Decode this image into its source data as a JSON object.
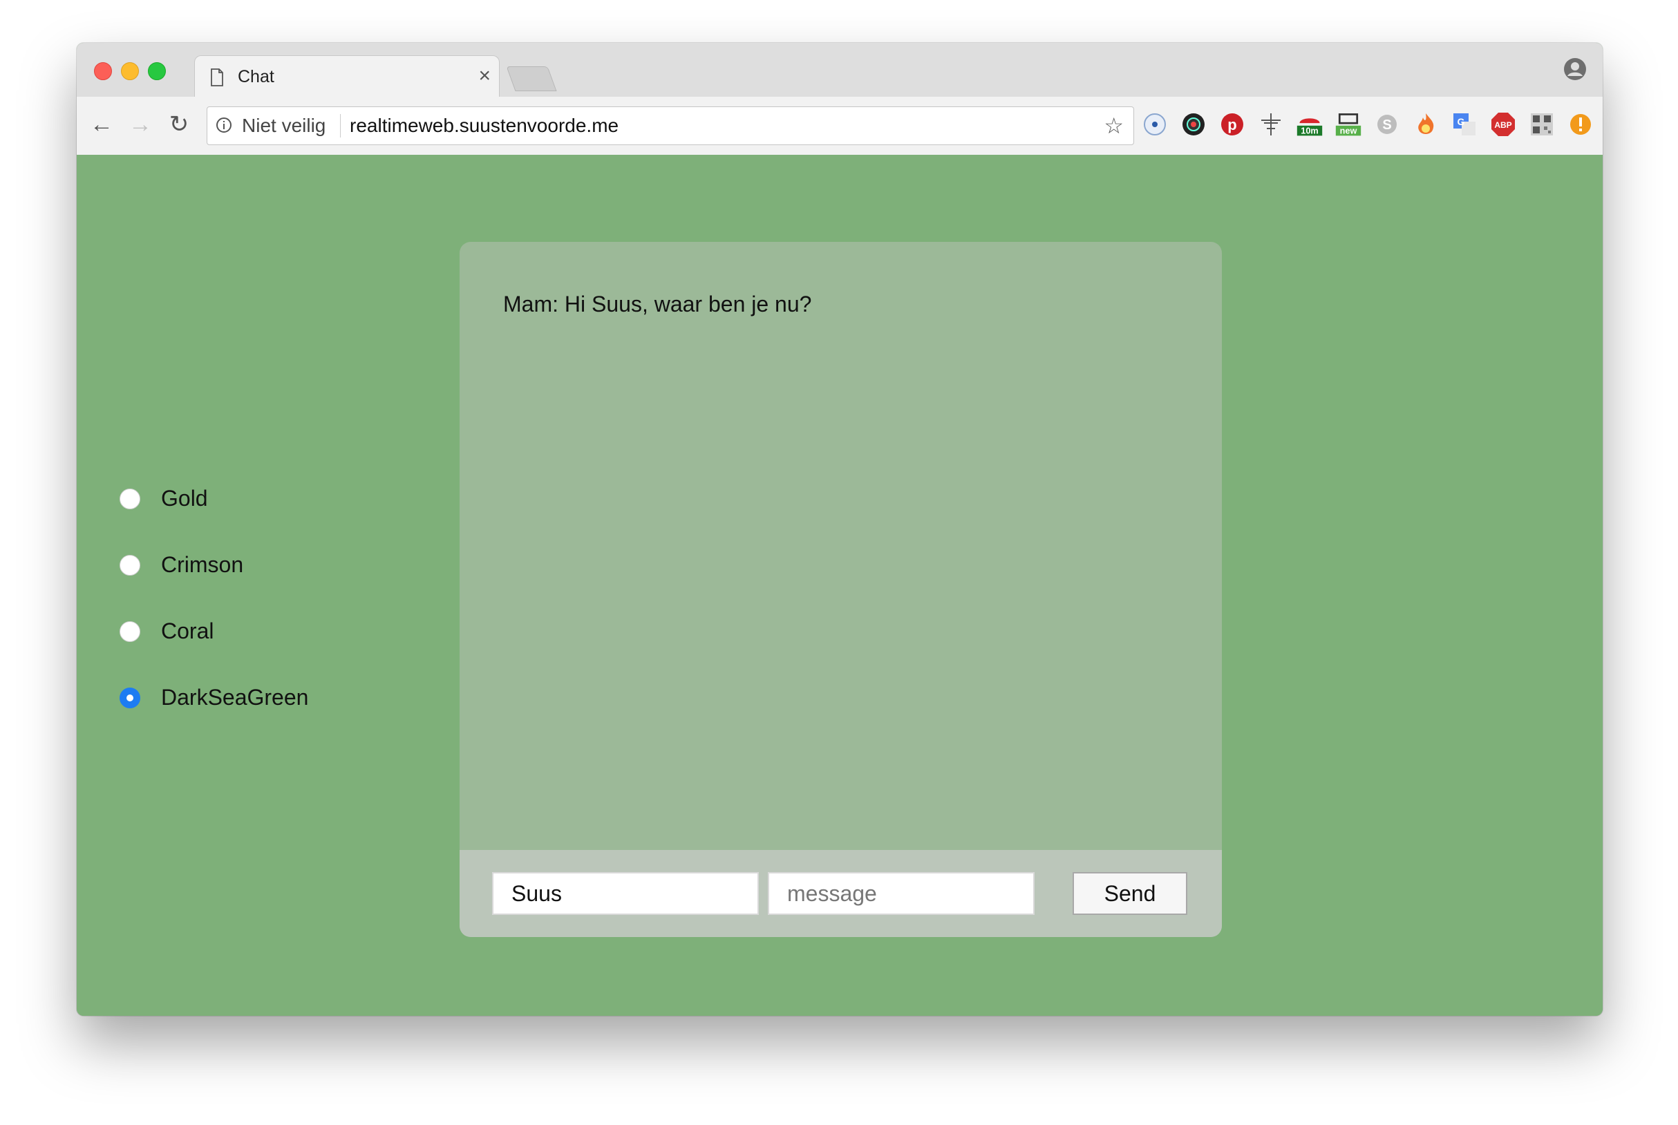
{
  "browser": {
    "tab_title": "Chat",
    "tab_close": "×",
    "security_label": "Niet veilig",
    "url": "realtimeweb.suustenvoorde.me",
    "extensions": [
      {
        "name": "circle-ext-icon"
      },
      {
        "name": "camera-ext-icon"
      },
      {
        "name": "pinterest-icon"
      },
      {
        "name": "move-cursor-icon"
      },
      {
        "name": "timer-ext-icon",
        "badge": "10m"
      },
      {
        "name": "window-ext-icon",
        "badge": "new"
      },
      {
        "name": "skype-icon"
      },
      {
        "name": "fire-ext-icon"
      },
      {
        "name": "translate-icon"
      },
      {
        "name": "adblock-icon",
        "label": "ABP"
      },
      {
        "name": "qr-code-icon"
      },
      {
        "name": "alert-ext-icon"
      }
    ]
  },
  "page": {
    "background_color": "#7eb079",
    "colors": [
      {
        "label": "Gold",
        "checked": false
      },
      {
        "label": "Crimson",
        "checked": false
      },
      {
        "label": "Coral",
        "checked": false
      },
      {
        "label": "DarkSeaGreen",
        "checked": true
      }
    ],
    "chat": {
      "messages": [
        {
          "text": "Mam: Hi Suus, waar ben je nu?"
        }
      ],
      "name_value": "Suus",
      "message_placeholder": "message",
      "send_label": "Send"
    }
  }
}
